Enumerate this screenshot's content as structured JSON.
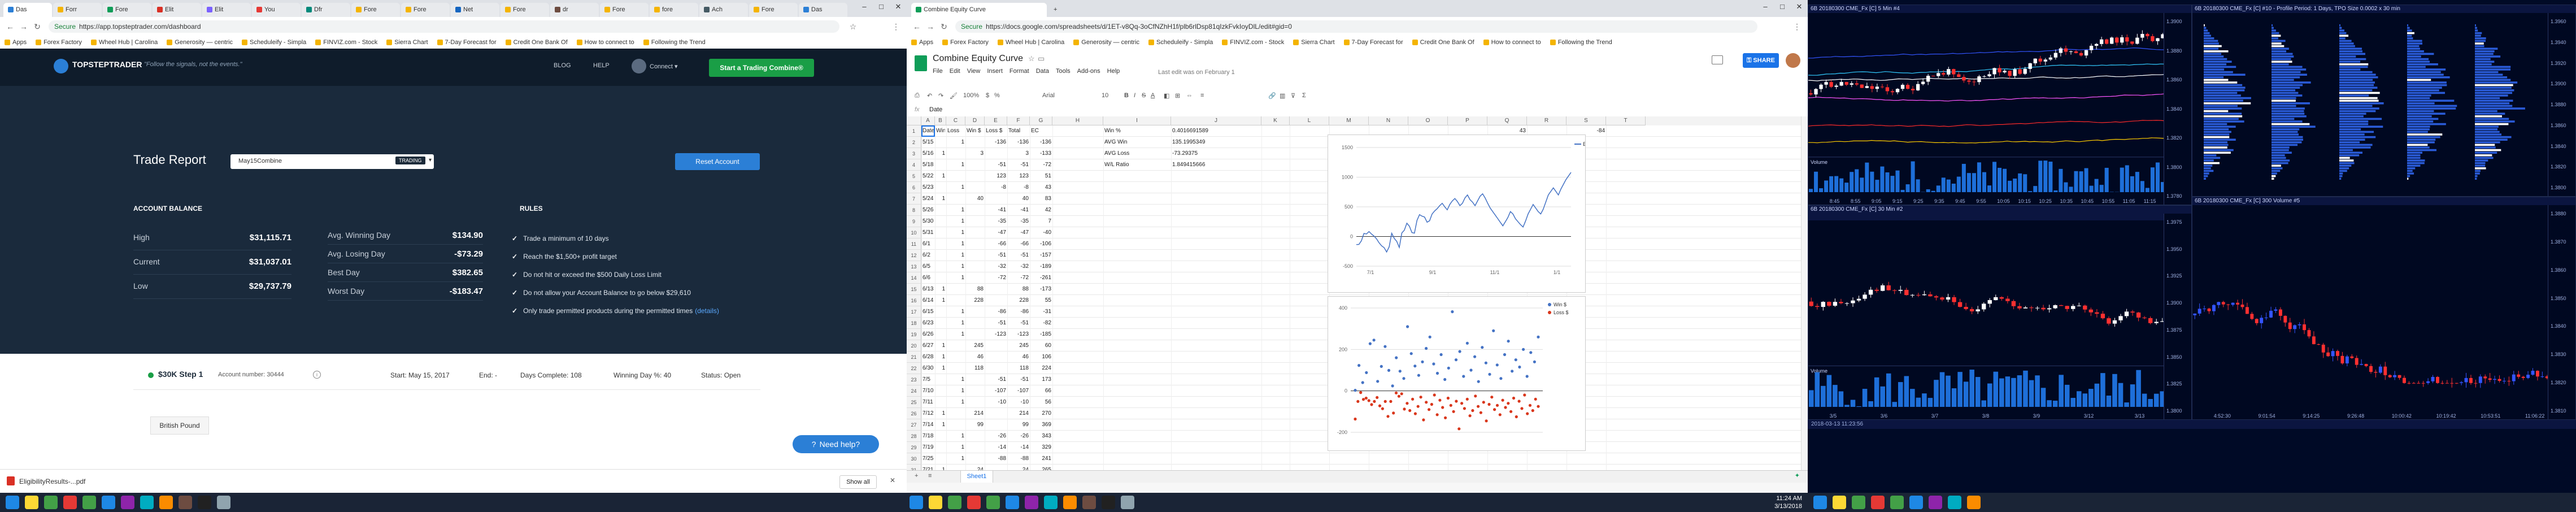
{
  "topstep_window": {
    "tabs": [
      "Das",
      "Forr",
      "Fore",
      "Elit",
      "Elit",
      "You",
      "Dfr",
      "Fore",
      "Fore",
      "Net",
      "Fore",
      "dr",
      "Fore",
      "fore",
      "Ach",
      "Fore",
      "Das"
    ],
    "url": "https://app.topsteptrader.com/dashboard",
    "secure_label": "Secure",
    "bookmarks": [
      "Apps",
      "Forex Factory",
      "Wheel Hub | Carolina",
      "Generosity — centric",
      "Scheduleify - Simpla",
      "FINVIZ.com - Stock",
      "Sierra Chart",
      "7-Day Forecast for",
      "Credit One Bank Of",
      "How to connect to",
      "Following the Trend"
    ],
    "header": {
      "logo": "TOPSTEPTRADER",
      "tagline": "\"Follow the signals, not the events.\"",
      "nav_blog": "BLOG",
      "nav_help": "HELP",
      "user": "Connect ▾",
      "cta": "Start a Trading Combine®"
    },
    "report": {
      "title": "Trade Report",
      "account_select": "May15Combine",
      "trading_badge": "TRADING",
      "reset_button": "Reset Account"
    },
    "balance": {
      "heading": "ACCOUNT BALANCE",
      "rows": [
        {
          "label": "High",
          "value": "$31,115.71"
        },
        {
          "label": "Current",
          "value": "$31,037.01"
        },
        {
          "label": "Low",
          "value": "$29,737.79"
        }
      ],
      "stats": [
        {
          "label": "Avg. Winning Day",
          "value": "$134.90"
        },
        {
          "label": "Avg. Losing Day",
          "value": "-$73.29"
        },
        {
          "label": "Best Day",
          "value": "$382.65"
        },
        {
          "label": "Worst Day",
          "value": "-$183.47"
        }
      ]
    },
    "rules": {
      "heading": "RULES",
      "items": [
        "Trade a minimum of 10 days",
        "Reach the $1,500+ profit target",
        "Do not hit or exceed the $500 Daily Loss Limit",
        "Do not allow your Account Balance to go below $29,610",
        "Only trade permitted products during the permitted times"
      ],
      "details_link": "(details)"
    },
    "account": {
      "name": "$30K Step 1",
      "number_label": "Account number: 30444",
      "start": "Start: May 15, 2017",
      "end": "End: -",
      "days_complete": "Days Complete: 108",
      "winning_days": "Winning Day %: 40",
      "status": "Status: Open",
      "product_button": "British Pound"
    },
    "need_help": "Need help?",
    "download_file": "EligibilityResults-...pdf",
    "show_all": "Show all"
  },
  "sheets_window": {
    "tab_title": "Combine Equity Curve",
    "url": "https://docs.google.com/spreadsheets/d/1ET-v8Qq-3oCfNZhH1f/plb6rlDsp81qIzkFvkIoyDlL/edit#gid=0",
    "secure_label": "Secure",
    "bookmarks": [
      "Apps",
      "Forex Factory",
      "Wheel Hub | Carolina",
      "Generosity — centric",
      "Scheduleify - Simpla",
      "FINVIZ.com - Stock",
      "Sierra Chart",
      "7-Day Forecast for",
      "Credit One Bank Of",
      "How to connect to",
      "Following the Trend"
    ],
    "doc_title": "Combine Equity Curve",
    "menus": [
      "File",
      "Edit",
      "View",
      "Insert",
      "Format",
      "Data",
      "Tools",
      "Add-ons",
      "Help"
    ],
    "last_edit": "Last edit was on February 1",
    "share": "SHARE",
    "formula_ref": "fx",
    "formula_value": "Date",
    "zoom": "100%",
    "font": "Arial",
    "font_size": "10",
    "col_letters": [
      "A",
      "B",
      "C",
      "D",
      "E",
      "F",
      "G",
      "H",
      "I",
      "J",
      "K",
      "L",
      "M",
      "N",
      "O",
      "P",
      "Q",
      "R",
      "S",
      "T"
    ],
    "headers": [
      "Date",
      "Win",
      "Loss",
      "Win $",
      "Loss $",
      "Total",
      "EC"
    ],
    "rows": [
      [
        "5/15",
        "",
        "1",
        "",
        "-136",
        "-136",
        "-136"
      ],
      [
        "5/16",
        "1",
        "",
        "3",
        "",
        "3",
        "-133"
      ],
      [
        "5/18",
        "",
        "1",
        "",
        "-51",
        "-51",
        "-72"
      ],
      [
        "5/22",
        "1",
        "",
        "",
        "123",
        "123",
        "51"
      ],
      [
        "5/23",
        "",
        "1",
        "",
        "-8",
        "-8",
        "43"
      ],
      [
        "5/24",
        "1",
        "",
        "40",
        "",
        "40",
        "83"
      ],
      [
        "5/26",
        "",
        "1",
        "",
        "-41",
        "-41",
        "42"
      ],
      [
        "5/30",
        "",
        "1",
        "",
        "-35",
        "-35",
        "7"
      ],
      [
        "5/31",
        "",
        "1",
        "",
        "-47",
        "-47",
        "-40"
      ],
      [
        "6/1",
        "",
        "1",
        "",
        "-66",
        "-66",
        "-106"
      ],
      [
        "6/2",
        "",
        "1",
        "",
        "-51",
        "-51",
        "-157"
      ],
      [
        "6/5",
        "",
        "1",
        "",
        "-32",
        "-32",
        "-189"
      ],
      [
        "6/6",
        "",
        "1",
        "",
        "-72",
        "-72",
        "-261"
      ],
      [
        "6/13",
        "1",
        "",
        "88",
        "",
        "88",
        "-173"
      ],
      [
        "6/14",
        "1",
        "",
        "228",
        "",
        "228",
        "55"
      ],
      [
        "6/15",
        "",
        "1",
        "",
        "-86",
        "-86",
        "-31"
      ],
      [
        "6/23",
        "",
        "1",
        "",
        "-51",
        "-51",
        "-82"
      ],
      [
        "6/26",
        "",
        "1",
        "",
        "-123",
        "-123",
        "-185"
      ],
      [
        "6/27",
        "1",
        "",
        "245",
        "",
        "245",
        "60"
      ],
      [
        "6/28",
        "1",
        "",
        "46",
        "",
        "46",
        "106"
      ],
      [
        "6/30",
        "1",
        "",
        "118",
        "",
        "118",
        "224"
      ],
      [
        "7/5",
        "",
        "1",
        "",
        "-51",
        "-51",
        "173"
      ],
      [
        "7/10",
        "",
        "1",
        "",
        "-107",
        "-107",
        "66"
      ],
      [
        "7/11",
        "",
        "1",
        "",
        "-10",
        "-10",
        "56"
      ],
      [
        "7/12",
        "1",
        "",
        "214",
        "",
        "214",
        "270"
      ],
      [
        "7/14",
        "1",
        "",
        "99",
        "",
        "99",
        "369"
      ],
      [
        "7/18",
        "",
        "1",
        "",
        "-26",
        "-26",
        "343"
      ],
      [
        "7/19",
        "",
        "1",
        "",
        "-14",
        "-14",
        "329"
      ],
      [
        "7/25",
        "",
        "1",
        "",
        "-88",
        "-88",
        "241"
      ],
      [
        "7/21",
        "1",
        "",
        "24",
        "",
        "24",
        "265"
      ]
    ],
    "summary": [
      {
        "label": "Win %",
        "value": "0.4016691589"
      },
      {
        "label": "AVG Win",
        "value": "135.1995349"
      },
      {
        "label": "AVG Loss",
        "value": "-73.29375"
      },
      {
        "label": "W/L Ratio",
        "value": "1.849415666"
      }
    ],
    "side_values": [
      "43",
      "-84",
      "107"
    ],
    "sheet_tab": "Sheet1"
  },
  "chart_data": [
    {
      "type": "line",
      "title": "",
      "series": [
        {
          "name": "EC",
          "color": "#4472c4"
        }
      ],
      "ylim": [
        -500,
        1500
      ],
      "yticks": [
        "1500",
        "1000",
        "500",
        "0",
        "-500"
      ],
      "xticks": [
        "7/1",
        "9/1",
        "11/1",
        "1/1"
      ],
      "values": [
        -136,
        -133,
        -72,
        51,
        43,
        83,
        42,
        7,
        -40,
        -106,
        -157,
        -189,
        -261,
        -173,
        55,
        -31,
        -82,
        -185,
        60,
        106,
        224,
        173,
        66,
        56,
        270,
        369,
        343,
        329,
        241,
        265,
        380,
        430,
        470,
        520,
        560,
        500,
        450,
        540,
        600,
        640,
        590,
        520,
        560,
        650,
        700,
        620,
        580,
        520,
        600,
        680,
        720,
        650,
        560,
        480,
        420,
        360,
        300,
        240,
        180,
        250,
        320,
        420,
        380,
        300,
        250,
        200,
        160,
        260,
        380,
        460,
        540,
        480,
        420,
        380,
        460,
        580,
        700,
        760,
        820,
        760,
        700,
        800,
        880,
        960,
        1020,
        1080
      ]
    },
    {
      "type": "scatter",
      "title": "",
      "series": [
        {
          "name": "Win $",
          "color": "#4472c4",
          "values": [
            3,
            123,
            40,
            88,
            228,
            245,
            46,
            118,
            214,
            99,
            24,
            160,
            95,
            60,
            310,
            180,
            120,
            75,
            140,
            205,
            260,
            130,
            85,
            175,
            55,
            110,
            382,
            150,
            190,
            70,
            230,
            100,
            165,
            45,
            210,
            135,
            80,
            290,
            125,
            60,
            175,
            240,
            95,
            150,
            115,
            200,
            70,
            185,
            140,
            260
          ]
        },
        {
          "name": "Loss $",
          "color": "#d9361b",
          "values": [
            -136,
            -51,
            -8,
            -41,
            -35,
            -47,
            -66,
            -51,
            -32,
            -72,
            -86,
            -51,
            -123,
            -51,
            -107,
            -10,
            -26,
            -14,
            -88,
            -60,
            -95,
            -40,
            -110,
            -75,
            -30,
            -140,
            -55,
            -90,
            -65,
            -20,
            -115,
            -45,
            -80,
            -130,
            -35,
            -70,
            -100,
            -50,
            -183,
            -60,
            -85,
            -40,
            -120,
            -95,
            -25,
            -75,
            -105,
            -55,
            -145,
            -65,
            -30,
            -90,
            -70,
            -115,
            -45,
            -80,
            -60,
            -100,
            -35,
            -125,
            -50,
            -85,
            -20,
            -110,
            -70,
            -95,
            -40,
            -75
          ]
        }
      ],
      "ylim": [
        -200,
        400
      ],
      "yticks": [
        "400",
        "200",
        "0",
        "-200"
      ]
    }
  ],
  "trading": {
    "panel_top_left": "6B 20180300 CME_Fx [C]  5 Min  #4",
    "panel_top_right": "6B 20180300 CME_Fx [C]  #10 - Profile Period: 1 Days, TPO Size 0.0002 x 30 min",
    "panel_bottom_left": "6B 20180300 CME_Fx [C]  30 Min  #2",
    "panel_bottom_right": "6B 20180300 CME_Fx [C]  300 Volume  #5",
    "volume_label": "Volume",
    "top_left_prices": [
      "1.3900",
      "1.3880",
      "1.3860",
      "1.3840",
      "1.3820",
      "1.3800",
      "1.3780"
    ],
    "top_right_prices": [
      "1.3960",
      "1.3940",
      "1.3920",
      "1.3900",
      "1.3880",
      "1.3860",
      "1.3840",
      "1.3820",
      "1.3800"
    ],
    "bottom_left_prices": [
      "1.3975",
      "1.3950",
      "1.3925",
      "1.3900",
      "1.3875",
      "1.3850",
      "1.3825",
      "1.3800"
    ],
    "bottom_right_prices": [
      "1.3880",
      "1.3870",
      "1.3860",
      "1.3850",
      "1.3840",
      "1.3830",
      "1.3820",
      "1.3810"
    ],
    "times_top_left": [
      "8:45",
      "8:55",
      "9:05",
      "9:15",
      "9:25",
      "9:35",
      "9:45",
      "9:55",
      "10:05",
      "10:15",
      "10:25",
      "10:35",
      "10:45",
      "10:55",
      "11:05",
      "11:15",
      "11:25"
    ],
    "times_bottom_left": [
      "3/5",
      "3/6",
      "3/7",
      "3/8",
      "3/9",
      "3/12",
      "3/13"
    ],
    "times_bottom_right": [
      "4:52:30",
      "9:01:54",
      "9:14:25",
      "9:26:48",
      "10:00:42",
      "10:19:42",
      "10:53:51",
      "11:06:22"
    ],
    "status": "2018-03-13 11:23:56"
  },
  "taskbar": {
    "time": "11:24 AM",
    "date": "3/13/2018"
  }
}
